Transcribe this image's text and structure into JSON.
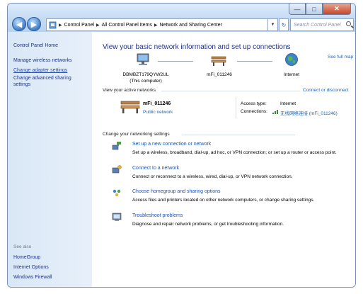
{
  "address": {
    "segments": [
      "Control Panel",
      "All Control Panel Items",
      "Network and Sharing Center"
    ],
    "search_placeholder": "Search Control Panel"
  },
  "sidebar": {
    "home": "Control Panel Home",
    "links": [
      "Manage wireless networks",
      "Change adapter settings",
      "Change advanced sharing settings"
    ],
    "see_also_label": "See also",
    "see_also": [
      "HomeGroup",
      "Internet Options",
      "Windows Firewall"
    ]
  },
  "main": {
    "heading": "View your basic network information and set up connections",
    "see_full_map": "See full map",
    "map": {
      "computer_name": "DBMBZT179QYW2UL",
      "computer_sub": "(This computer)",
      "network_name": "mFi_011246",
      "internet": "Internet"
    },
    "active_label": "View your active networks",
    "connect_disconnect": "Connect or disconnect",
    "active": {
      "name": "mFi_011246",
      "type": "Public network",
      "access_type_label": "Access type:",
      "access_type_value": "Internet",
      "connections_label": "Connections:",
      "connections_value": "无线网络连接 (mFi_011246)"
    },
    "settings_label": "Change your networking settings",
    "tasks": [
      {
        "title": "Set up a new connection or network",
        "desc": "Set up a wireless, broadband, dial-up, ad hoc, or VPN connection; or set up a router or access point."
      },
      {
        "title": "Connect to a network",
        "desc": "Connect or reconnect to a wireless, wired, dial-up, or VPN network connection."
      },
      {
        "title": "Choose homegroup and sharing options",
        "desc": "Access files and printers located on other network computers, or change sharing settings."
      },
      {
        "title": "Troubleshoot problems",
        "desc": "Diagnose and repair network problems, or get troubleshooting information."
      }
    ]
  },
  "window_buttons": {
    "minimize": "—",
    "maximize": "□",
    "close": "✕"
  },
  "icons": [
    "back-icon",
    "forward-icon",
    "control-panel-icon",
    "refresh-icon",
    "search-icon",
    "computer-icon",
    "bench-icon",
    "globe-icon",
    "setup-icon",
    "connect-icon",
    "homegroup-icon",
    "troubleshoot-icon"
  ],
  "colors": {
    "link": "#1e3287",
    "accent_link": "#1c63b8",
    "sidebar_bg": "#dde9f6",
    "title_bg": "#c4dbf3"
  }
}
